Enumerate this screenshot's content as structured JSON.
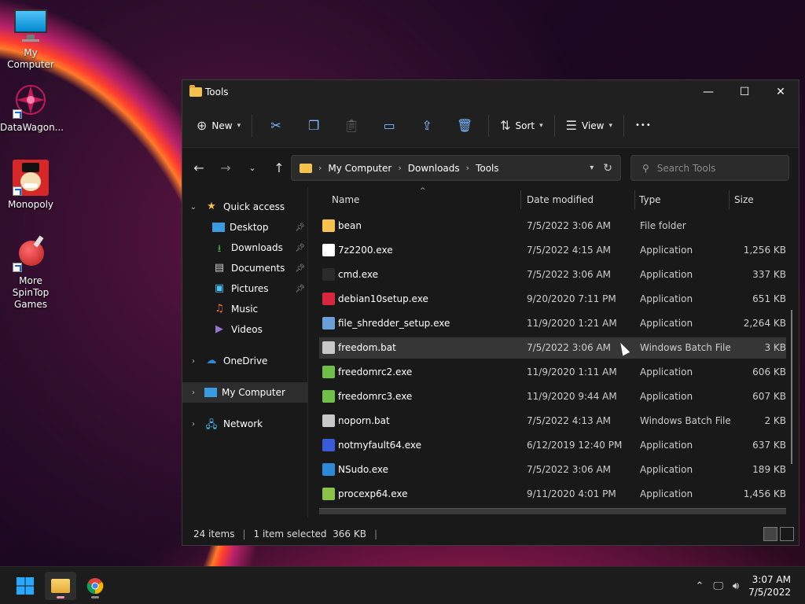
{
  "desktop": {
    "icons": [
      {
        "label": "My Computer",
        "icon": "monitor-icon"
      },
      {
        "label": "DataWagon...",
        "icon": "datawagon-icon"
      },
      {
        "label": "Monopoly",
        "icon": "monopoly-icon"
      },
      {
        "label": "More SpinTop Games",
        "icon": "spintop-icon"
      }
    ]
  },
  "window": {
    "title": "Tools",
    "controls": {
      "minimize": "—",
      "maximize": "☐",
      "close": "✕"
    }
  },
  "toolbar": {
    "new_label": "New",
    "sort_label": "Sort",
    "view_label": "View",
    "more_label": "•••"
  },
  "address": {
    "crumbs": [
      "My Computer",
      "Downloads",
      "Tools"
    ]
  },
  "search": {
    "placeholder": "Search Tools"
  },
  "sidebar": {
    "quick_access": "Quick access",
    "items": [
      "Desktop",
      "Downloads",
      "Documents",
      "Pictures",
      "Music",
      "Videos"
    ],
    "onedrive": "OneDrive",
    "mycomputer": "My Computer",
    "network": "Network"
  },
  "columns": {
    "name": "Name",
    "date": "Date modified",
    "type": "Type",
    "size": "Size"
  },
  "files": [
    {
      "name": "bean",
      "date": "7/5/2022 3:06 AM",
      "type": "File folder",
      "size": "",
      "color": "#f4c24d"
    },
    {
      "name": "7z2200.exe",
      "date": "7/5/2022 4:15 AM",
      "type": "Application",
      "size": "1,256 KB",
      "color": "#ffffff"
    },
    {
      "name": "cmd.exe",
      "date": "7/5/2022 3:06 AM",
      "type": "Application",
      "size": "337 KB",
      "color": "#2a2a2a"
    },
    {
      "name": "debian10setup.exe",
      "date": "9/20/2020 7:11 PM",
      "type": "Application",
      "size": "651 KB",
      "color": "#d7263d"
    },
    {
      "name": "file_shredder_setup.exe",
      "date": "11/9/2020 1:21 AM",
      "type": "Application",
      "size": "2,264 KB",
      "color": "#6aa0d8"
    },
    {
      "name": "freedom.bat",
      "date": "7/5/2022 3:06 AM",
      "type": "Windows Batch File",
      "size": "3 KB",
      "color": "#c8c8c8"
    },
    {
      "name": "freedomrc2.exe",
      "date": "11/9/2020 1:11 AM",
      "type": "Application",
      "size": "606 KB",
      "color": "#6fbf4a"
    },
    {
      "name": "freedomrc3.exe",
      "date": "11/9/2020 9:44 AM",
      "type": "Application",
      "size": "607 KB",
      "color": "#6fbf4a"
    },
    {
      "name": "noporn.bat",
      "date": "7/5/2022 4:13 AM",
      "type": "Windows Batch File",
      "size": "2 KB",
      "color": "#c8c8c8"
    },
    {
      "name": "notmyfault64.exe",
      "date": "6/12/2019 12:40 PM",
      "type": "Application",
      "size": "637 KB",
      "color": "#3a5bd8"
    },
    {
      "name": "NSudo.exe",
      "date": "7/5/2022 3:06 AM",
      "type": "Application",
      "size": "189 KB",
      "color": "#2e8ad8"
    },
    {
      "name": "procexp64.exe",
      "date": "9/11/2020 4:01 PM",
      "type": "Application",
      "size": "1,456 KB",
      "color": "#8bc34a"
    }
  ],
  "status": {
    "count": "24 items",
    "selected": "1 item selected  366 KB"
  },
  "taskbar": {
    "time": "3:07 AM",
    "date": "7/5/2022"
  }
}
